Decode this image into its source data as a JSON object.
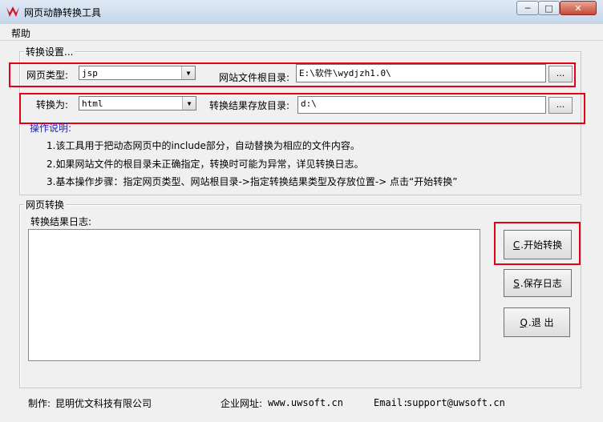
{
  "window": {
    "title": "网页动静转换工具",
    "accent_color": "#e60012",
    "controls": {
      "minimize": "─",
      "maximize": "□",
      "close": "✕"
    }
  },
  "menu": {
    "items": [
      "帮助"
    ]
  },
  "settings": {
    "legend": "转换设置...",
    "page_type_label": "网页类型:",
    "page_type_value": "jsp",
    "site_root_label": "网站文件根目录:",
    "site_root_value": "E:\\软件\\wydjzh1.0\\",
    "convert_to_label": "转换为:",
    "convert_to_value": "html",
    "output_dir_label": "转换结果存放目录:",
    "output_dir_value": "d:\\",
    "browse_label": "...",
    "instructions_title": "操作说明:",
    "instructions": [
      "1.该工具用于把动态网页中的include部分，自动替换为相应的文件内容。",
      "2.如果网站文件的根目录未正确指定，转换时可能为异常，详见转换日志。",
      "3.基本操作步骤：指定网页类型、网站根目录->指定转换结果类型及存放位置-> 点击“开始转换”"
    ]
  },
  "conversion": {
    "legend": "网页转换",
    "log_label": "转换结果日志:",
    "log_text": "",
    "start_key": "C",
    "start_label": ".开始转换",
    "save_key": "S",
    "save_label": ".保存日志",
    "exit_key": "Q",
    "exit_label": ".退  出"
  },
  "footer": {
    "maker_label": "制作:",
    "maker_value": "昆明优文科技有限公司",
    "site_label": "企业网址:",
    "site_value": "www.uwsoft.cn",
    "email_label": "Email:",
    "email_value": "support@uwsoft.cn"
  }
}
